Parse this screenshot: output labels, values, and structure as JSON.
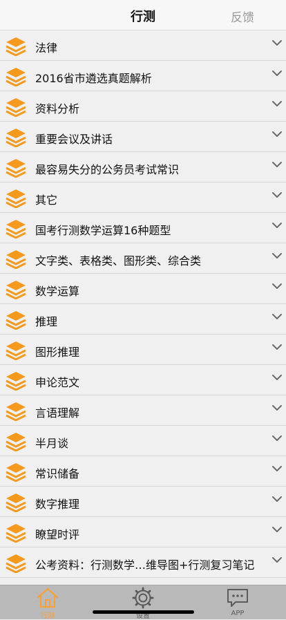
{
  "header": {
    "title": "行测",
    "right_action": "反馈"
  },
  "icons": {
    "row_icon": "layers-stack-icon",
    "row_chevron": "chevron-down-icon",
    "accent": "#f39a1f"
  },
  "list": {
    "items": [
      {
        "label": "法律"
      },
      {
        "label": "2016省市遴选真题解析"
      },
      {
        "label": "资料分析"
      },
      {
        "label": "重要会议及讲话"
      },
      {
        "label": "最容易失分的公务员考试常识"
      },
      {
        "label": "其它"
      },
      {
        "label": "国考行测数学运算16种题型"
      },
      {
        "label": "文字类、表格类、图形类、综合类"
      },
      {
        "label": "数学运算"
      },
      {
        "label": "推理"
      },
      {
        "label": "图形推理"
      },
      {
        "label": "申论范文"
      },
      {
        "label": "言语理解"
      },
      {
        "label": "半月谈"
      },
      {
        "label": "常识储备"
      },
      {
        "label": "数字推理"
      },
      {
        "label": "瞭望时评"
      },
      {
        "label": "公考资料：行测数学…维导图+行测复习笔记"
      }
    ]
  },
  "tabbar": {
    "tabs": [
      {
        "label": "行测",
        "icon": "house-icon",
        "active": true
      },
      {
        "label": "设置",
        "icon": "gear-icon",
        "active": false
      },
      {
        "label": "APP",
        "icon": "chat-bubble-icon",
        "active": false
      }
    ]
  }
}
